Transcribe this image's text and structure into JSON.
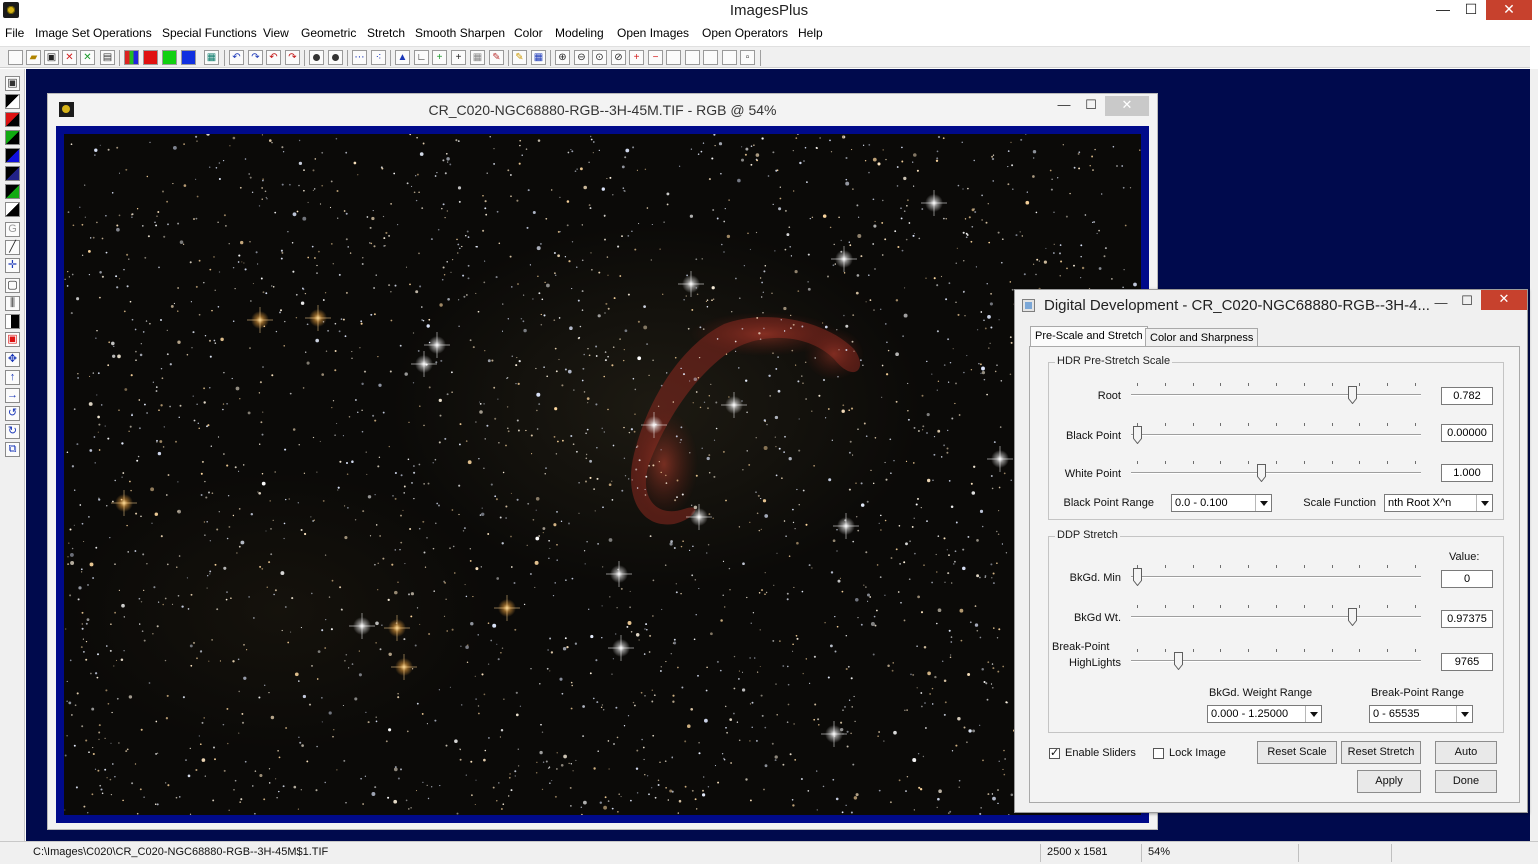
{
  "app": {
    "title": "ImagesPlus",
    "window_buttons": {
      "minimize": "—",
      "maximize": "☐",
      "close": "✕"
    }
  },
  "menu": [
    "File",
    "Image Set Operations",
    "Special Functions",
    "View",
    "Geometric",
    "Stretch",
    "Smooth Sharpen",
    "Color",
    "Modeling",
    "Open Images",
    "Open Operators",
    "Help"
  ],
  "toolbar": {
    "icons": [
      "new-icon",
      "open-icon",
      "save-icon",
      "close-red-icon",
      "close-green-icon",
      "print-icon",
      "rgb-channels-icon",
      "red-channel-icon",
      "green-channel-icon",
      "blue-channel-icon",
      "grid-icon",
      "undo-icon",
      "redo-icon",
      "undo-all-icon",
      "redo-all-icon",
      "circle-filled-icon",
      "circle-red-icon",
      "dots-icon",
      "scatter-icon",
      "triangle-icon",
      "corner-icon",
      "plus-green-icon",
      "crosshair-icon",
      "table-icon",
      "paint-icon",
      "pencil-icon",
      "grid-blue-icon",
      "zoom-in-icon",
      "zoom-out-icon",
      "zoom-fit-icon",
      "zoom-actual-icon",
      "plus-box-icon",
      "minus-box-icon",
      "frame-icon",
      "frame-small-icon",
      "frame-medium-icon",
      "frame-large-icon",
      "dot-box-icon"
    ]
  },
  "image_window": {
    "title": "CR_C020-NGC68880-RGB--3H-45M.TIF - RGB @ 54%",
    "buttons": {
      "minimize": "—",
      "maximize": "☐",
      "close": "✕"
    }
  },
  "status": {
    "path": "C:\\Images\\C020\\CR_C020-NGC68880-RGB--3H-45M$1.TIF",
    "dimensions": "2500 x 1581",
    "zoom": "54%"
  },
  "dialog": {
    "title": "Digital Development - CR_C020-NGC68880-RGB--3H-4...",
    "buttons": {
      "minimize": "—",
      "maximize": "☐",
      "close": "✕"
    },
    "tabs": [
      {
        "label": "Pre-Scale and Stretch",
        "active": true
      },
      {
        "label": "Color and Sharpness",
        "active": false
      }
    ],
    "hdr_group": {
      "legend": "HDR Pre-Stretch Scale",
      "root": {
        "label": "Root",
        "value": "0.782",
        "position": 0.78
      },
      "black_point": {
        "label": "Black Point",
        "value": "0.00000",
        "position": 0.0
      },
      "white_point": {
        "label": "White Point",
        "value": "1.000",
        "position": 0.45
      },
      "black_point_range": {
        "label": "Black Point Range",
        "selected": "0.0 - 0.100"
      },
      "scale_function": {
        "label": "Scale Function",
        "selected": "nth Root X^n"
      }
    },
    "ddp_group": {
      "legend": "DDP Stretch",
      "value_header": "Value:",
      "bkgd_min": {
        "label": "BkGd. Min",
        "value": "0",
        "position": 0.0
      },
      "bkgd_wt": {
        "label": "BkGd Wt.",
        "value": "0.97375",
        "position": 0.78
      },
      "break_point": {
        "label_line1": "Break-Point",
        "label_line2": "HighLights",
        "value": "9765",
        "position": 0.15
      },
      "bkgd_weight_range": {
        "label": "BkGd. Weight Range",
        "selected": "0.000 - 1.25000"
      },
      "break_point_range": {
        "label": "Break-Point Range",
        "selected": "0 - 65535"
      }
    },
    "enable_sliders": {
      "label": "Enable Sliders",
      "checked": true
    },
    "lock_image": {
      "label": "Lock Image",
      "checked": false
    },
    "reset_scale": "Reset Scale",
    "reset_stretch": "Reset Stretch",
    "auto": "Auto",
    "apply": "Apply",
    "done": "Done"
  },
  "colors": {
    "workspace": "#000a4d",
    "image_frame": "#000a8a",
    "close_red": "#c7412d",
    "nebula": "#a0322a"
  }
}
